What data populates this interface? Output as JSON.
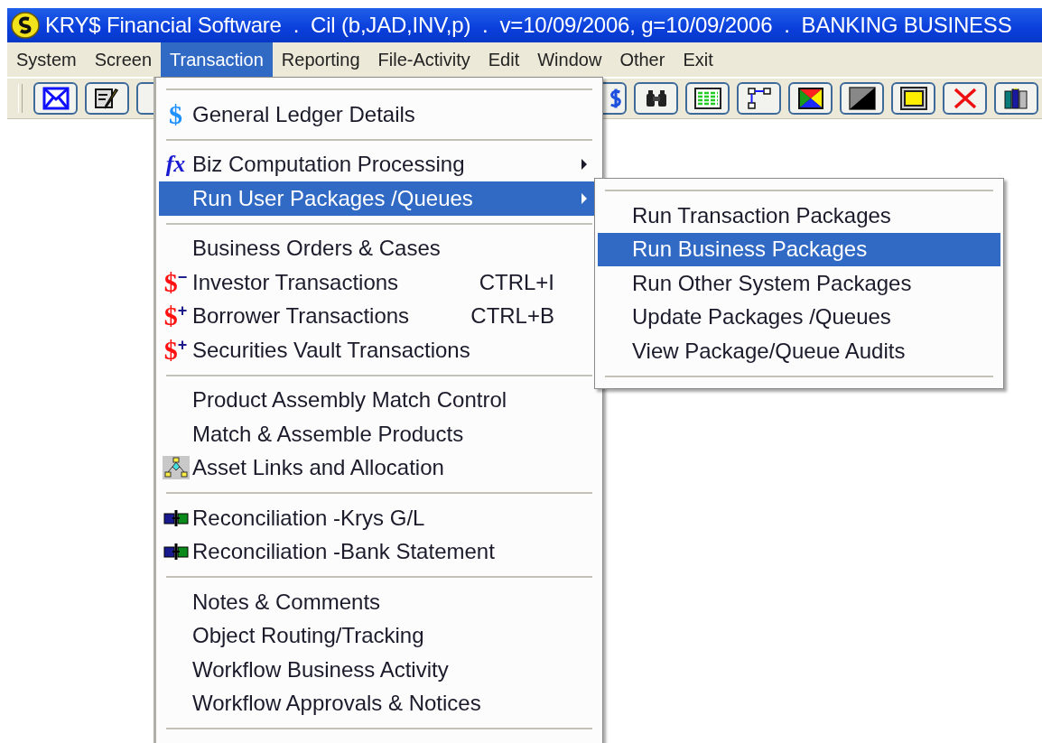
{
  "window": {
    "title": "KRY$ Financial Software  .  Cil (b,JAD,INV,p)  .  v=10/09/2006, g=10/09/2006  .  BANKING BUSINESS"
  },
  "menu_bar": [
    {
      "label": "System",
      "selected": false
    },
    {
      "label": "Screen",
      "selected": false
    },
    {
      "label": "Transaction",
      "selected": true
    },
    {
      "label": "Reporting",
      "selected": false
    },
    {
      "label": "File-Activity",
      "selected": false
    },
    {
      "label": "Edit",
      "selected": false
    },
    {
      "label": "Window",
      "selected": false
    },
    {
      "label": "Other",
      "selected": false
    },
    {
      "label": "Exit",
      "selected": false
    }
  ],
  "toolbar": {
    "left": [
      {
        "kind": "envelope"
      },
      {
        "kind": "notepad"
      },
      {
        "kind": "covered"
      }
    ],
    "right": [
      {
        "kind": "dollar"
      },
      {
        "kind": "binoculars"
      },
      {
        "kind": "grid"
      },
      {
        "kind": "flowchart"
      },
      {
        "kind": "colors"
      },
      {
        "kind": "diagonal"
      },
      {
        "kind": "frame"
      },
      {
        "kind": "cross"
      },
      {
        "kind": "books"
      }
    ]
  },
  "menu": [
    {
      "kind": "separator"
    },
    {
      "kind": "item",
      "label": "General Ledger Details",
      "icon": {
        "kind": "blue-dollar",
        "glyph": "$"
      },
      "selected": false
    },
    {
      "kind": "separator"
    },
    {
      "kind": "item",
      "label": "Biz Computation Processing",
      "icon": {
        "kind": "fx",
        "glyph": "fx"
      },
      "submenu": true,
      "selected": false
    },
    {
      "kind": "item",
      "label": "Run User Packages /Queues",
      "submenu": true,
      "selected": true
    },
    {
      "kind": "separator"
    },
    {
      "kind": "item",
      "label": "Business Orders & Cases",
      "selected": false
    },
    {
      "kind": "item",
      "label": "Investor Transactions",
      "icon": {
        "kind": "red-dollar",
        "glyph": "$",
        "sign": "−"
      },
      "shortcut": "CTRL+I",
      "selected": false
    },
    {
      "kind": "item",
      "label": "Borrower Transactions",
      "icon": {
        "kind": "red-dollar",
        "glyph": "$",
        "sign": "+"
      },
      "shortcut": "CTRL+B",
      "selected": false
    },
    {
      "kind": "item",
      "label": "Securities Vault Transactions",
      "icon": {
        "kind": "red-dollar",
        "glyph": "$",
        "sign": "+"
      },
      "selected": false
    },
    {
      "kind": "separator"
    },
    {
      "kind": "item",
      "label": "Product Assembly Match Control",
      "selected": false
    },
    {
      "kind": "item",
      "label": "Match & Assemble Products",
      "selected": false
    },
    {
      "kind": "item",
      "label": "Asset Links and Allocation",
      "icon": {
        "kind": "hierarchy"
      },
      "selected": false
    },
    {
      "kind": "separator"
    },
    {
      "kind": "item",
      "label": "Reconciliation -Krys G/L",
      "icon": {
        "kind": "reconcile"
      },
      "selected": false
    },
    {
      "kind": "item",
      "label": "Reconciliation -Bank Statement",
      "icon": {
        "kind": "reconcile"
      },
      "selected": false
    },
    {
      "kind": "separator"
    },
    {
      "kind": "item",
      "label": "Notes & Comments",
      "selected": false
    },
    {
      "kind": "item",
      "label": "Object Routing/Tracking",
      "selected": false
    },
    {
      "kind": "item",
      "label": "Workflow Business Activity",
      "selected": false
    },
    {
      "kind": "item",
      "label": "Workflow Approvals & Notices",
      "selected": false
    },
    {
      "kind": "separator"
    }
  ],
  "submenu": [
    {
      "kind": "separator"
    },
    {
      "kind": "item",
      "label": "Run Transaction Packages",
      "selected": false
    },
    {
      "kind": "item",
      "label": "Run Business Packages",
      "selected": true
    },
    {
      "kind": "item",
      "label": "Run Other System Packages",
      "selected": false
    },
    {
      "kind": "item",
      "label": "Update Packages /Queues",
      "selected": false
    },
    {
      "kind": "item",
      "label": "View Package/Queue Audits",
      "selected": false
    },
    {
      "kind": "separator"
    }
  ]
}
